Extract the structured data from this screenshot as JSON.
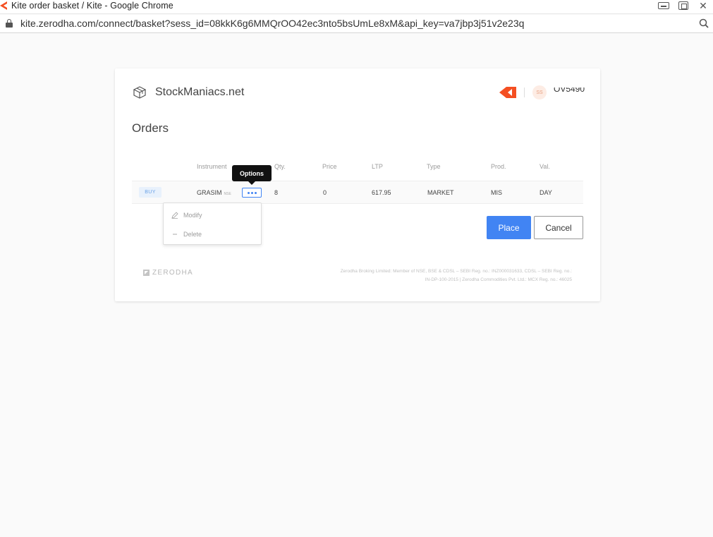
{
  "window": {
    "title": "Kite order basket / Kite - Google Chrome",
    "url": "kite.zerodha.com/connect/basket?sess_id=08kkK6g6MMQrOO42ec3nto5bsUmLe8xM&api_key=va7jbp3j51v2e23q"
  },
  "header": {
    "app_name": "StockManiacs.net",
    "avatar_initials": "SS",
    "user_id": "OV5490"
  },
  "page": {
    "title": "Orders"
  },
  "table": {
    "columns": [
      "Instrument",
      "Qty.",
      "Price",
      "LTP",
      "Type",
      "Prod.",
      "Val."
    ],
    "rows": [
      {
        "side": "BUY",
        "instrument": "GRASIM",
        "exchange": "NSE",
        "qty": "8",
        "price": "0",
        "ltp": "617.95",
        "type": "MARKET",
        "prod": "MIS",
        "val": "DAY"
      }
    ]
  },
  "tooltip": "Options",
  "options_menu": {
    "modify": "Modify",
    "delete": "Delete"
  },
  "actions": {
    "place": "Place",
    "cancel": "Cancel"
  },
  "footer": {
    "brand": "ZERODHA",
    "line1": "Zerodha Broking Limited: Member of NSE, BSE & CDSL – SEBI Reg. no.: INZ000031633, CDSL – SEBI Reg. no.:",
    "line2": "IN-DP-100-2015 | Zerodha Commodities Pvt. Ltd.: MCX Reg. no.: 46025"
  },
  "colors": {
    "accent": "#4184f3",
    "kite": "#f44f22",
    "buy_bg": "#e8f1fc"
  },
  "icons": [
    "kite-favicon-icon",
    "lock-icon",
    "zoom-icon",
    "cube-icon",
    "kite-logo-icon",
    "pencil-icon",
    "minus-icon",
    "zerodha-logo-icon"
  ]
}
